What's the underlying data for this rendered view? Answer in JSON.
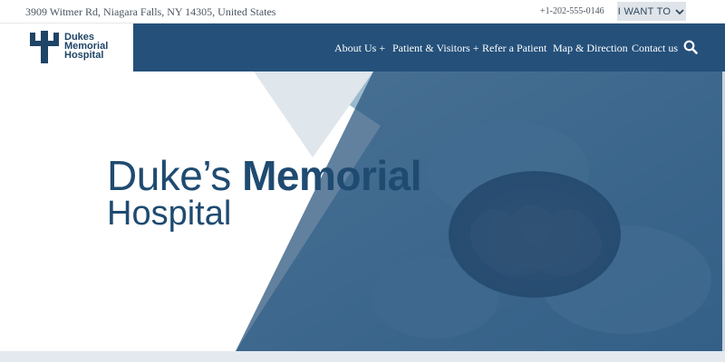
{
  "topbar": {
    "address": "3909 Witmer Rd, Niagara Falls, NY 14305, United States",
    "phone": "+1-202-555-0146",
    "i_want_to": "I WANT TO"
  },
  "logo": {
    "line1": "Dukes",
    "line2": "Memorial",
    "line3": "Hospital"
  },
  "nav": {
    "items": [
      {
        "label": "About Us +"
      },
      {
        "label": "Patient & Visitors +"
      },
      {
        "label": "Refer a Patient"
      },
      {
        "label": "Map & Direction"
      },
      {
        "label": "Contact us"
      }
    ]
  },
  "hero": {
    "title_part1": "Duke’s",
    "title_part2": "Memorial",
    "subtitle": "Hospital"
  },
  "colors": {
    "brand_blue": "#24507a",
    "title_blue": "#1f4b71",
    "button_bg": "#dfe4ea"
  },
  "icons": [
    "chevron-down-icon",
    "logo-cross-icon",
    "search-icon"
  ]
}
